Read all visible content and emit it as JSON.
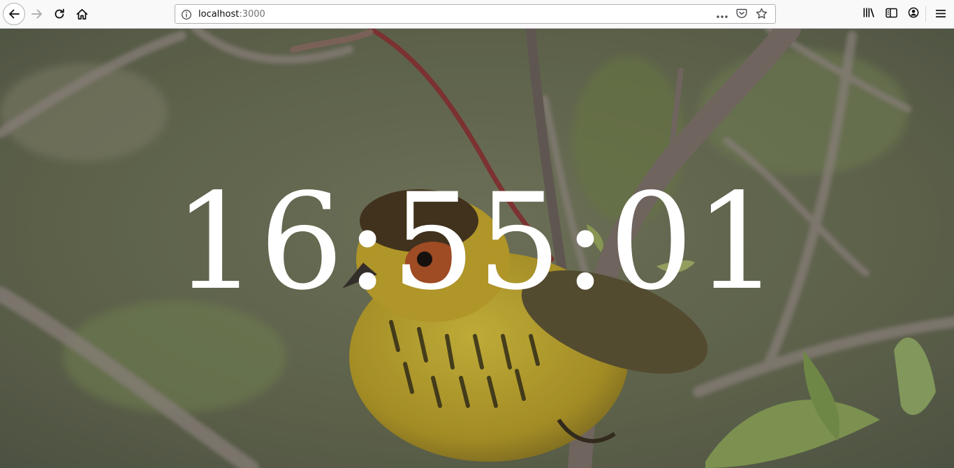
{
  "browser": {
    "url_host": "localhost",
    "url_port": ":3000",
    "icons": {
      "back": "back-arrow-icon",
      "forward": "forward-arrow-icon",
      "reload": "reload-icon",
      "home": "home-icon",
      "site_info": "info-icon",
      "page_actions": "more-dots-icon",
      "pocket": "pocket-icon",
      "bookmark": "star-icon",
      "library": "library-icon",
      "sidebar": "sidebar-icon",
      "account": "account-icon",
      "menu": "hamburger-menu-icon"
    }
  },
  "page": {
    "time": "16:55:01",
    "background": "photo of a yellow streaked warbler perched on a branch",
    "text_color": "#ffffff"
  }
}
